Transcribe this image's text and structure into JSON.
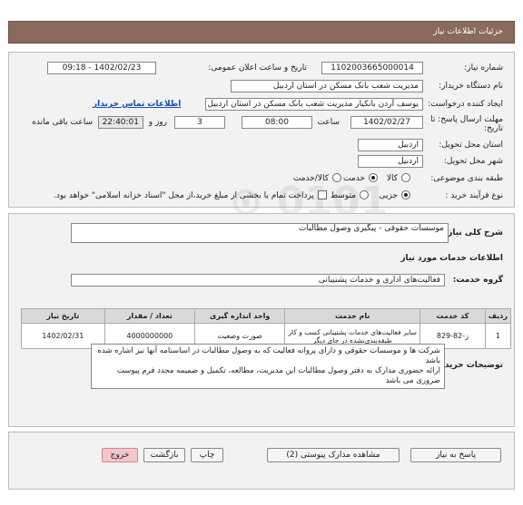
{
  "page": {
    "title": "جزئیات اطلاعات نیاز"
  },
  "info": {
    "need_number_label": "شماره نیاز:",
    "need_number": "1102003665000014",
    "announce_label": "تاریخ و ساعت اعلان عمومی:",
    "announce_value": "1402/02/23 - 09:18",
    "buyer_label": "نام دستگاه خریدار:",
    "buyer_value": "مدیریت شعب بانک مسکن در استان اردبیل",
    "creator_label": "ایجاد کننده درخواست:",
    "creator_value": "یوسف  آردن بانکیار مدیریت شعب بانک مسکن در استان اردبیل",
    "contact_link": "اطلاعات تماس خریدار",
    "deadline_label": "مهلت ارسال پاسخ: تا تاریخ:",
    "deadline_date": "1402/02/27",
    "time_label": "ساعت",
    "deadline_time": "08:00",
    "days_value": "3",
    "days_label": "روز و",
    "remaining_time": "22:40:01",
    "remaining_label": "ساعت باقی مانده",
    "province_label": "استان محل تحویل:",
    "province_value": "اردبیل",
    "city_label": "شهر محل تحویل:",
    "city_value": "اردبیل",
    "category_label": "طبقه بندی موضوعی:",
    "category_options": [
      "کالا",
      "خدمت",
      "کالا/خدمت"
    ],
    "process_label": "نوع فرآیند خرید :",
    "process_options": [
      "جزیی",
      "متوسط"
    ],
    "payment_note": "پرداخت تمام یا بخشی از مبلغ خرید،از محل \"اسناد خزانه اسلامی\" خواهد بود."
  },
  "summary": {
    "label": "شرح کلی نیاز:",
    "value": "موسسات حقوقی - پیگیری وصول مطالبات"
  },
  "services": {
    "section_title": "اطلاعات خدمات مورد نیاز",
    "group_label": "گروه خدمت:",
    "group_value": "فعالیت‌های اداری و خدمات پشتیبانی",
    "columns": [
      "ردیف",
      "کد خدمت",
      "نام خدمت",
      "واحد اندازه گیری",
      "تعداد / مقدار",
      "تاریخ نیاز"
    ],
    "rows": [
      [
        "1",
        "ز-82-829",
        "سایر فعالیت‌های خدمات پشتیبانی کسب و کار طبقه‌بندی‌نشده در جای دیگر",
        "صورت وضعیت",
        "4000000000",
        "1402/02/31"
      ]
    ]
  },
  "buyer_notes": {
    "label": "توضیحات خریدار:",
    "text": "شرکت ها و موسسات حقوقی و دارای پروانه فعالیت که به وصول مطالبات در اساسنامه آنها نیز اشاره شده باشد\nارائه حضوری مدارک به دفتر وصول مطالبات این مدیریت، مطالعه، تکمیل و ضمیمه مجدد فرم پیوست ضروری می باشد"
  },
  "buttons": {
    "reply": "پاسخ به نیاز",
    "attachments": "مشاهده مدارک پیوستی (2)",
    "print": "چاپ",
    "back": "بازگشت",
    "exit": "خروج"
  },
  "watermark": "ParsNamadData"
}
